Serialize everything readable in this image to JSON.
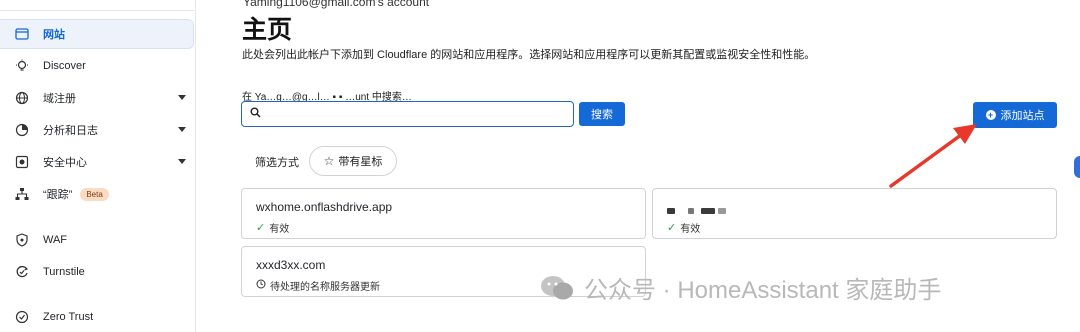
{
  "sidebar": {
    "items": [
      {
        "label": "网站",
        "icon": "browser-window-icon",
        "active": true,
        "caret": false
      },
      {
        "label": "Discover",
        "icon": "lightbulb-icon",
        "active": false,
        "caret": false
      },
      {
        "label": "域注册",
        "icon": "globe-icon",
        "active": false,
        "caret": true
      },
      {
        "label": "分析和日志",
        "icon": "clock-chart-icon",
        "active": false,
        "caret": true
      },
      {
        "label": "安全中心",
        "icon": "shield-gear-icon",
        "active": false,
        "caret": true
      },
      {
        "label": "“跟踪”",
        "icon": "network-tree-icon",
        "active": false,
        "caret": false,
        "badge": "Beta"
      },
      {
        "label": "WAF",
        "icon": "waf-shield-icon",
        "active": false,
        "caret": false
      },
      {
        "label": "Turnstile",
        "icon": "turnstile-icon",
        "active": false,
        "caret": false
      },
      {
        "label": "Zero Trust",
        "icon": "zero-trust-icon",
        "active": false,
        "caret": false
      }
    ]
  },
  "header": {
    "account": "Yaming1106@gmail.com's account",
    "title": "主页",
    "description": "此处会列出此帐户下添加到 Cloudflare 的网站和应用程序。选择网站和应用程序可以更新其配置或监视安全性和性能。"
  },
  "search": {
    "label": "在 Ya…g…@g…l… ▪ ▪ …unt 中搜索…",
    "value": "",
    "button": "搜索"
  },
  "add_site": {
    "label": "添加站点",
    "icon": "plus-circle-icon"
  },
  "filter": {
    "label": "筛选方式",
    "starred": "带有星标",
    "icon": "star-icon"
  },
  "sites": [
    {
      "domain": "wxhome.onflashdrive.app",
      "status": "有效",
      "status_icon": "check-icon"
    },
    {
      "domain": "",
      "status": "有效",
      "status_icon": "check-icon",
      "redacted": true
    },
    {
      "domain": "xxxd3xx.com",
      "status": "待处理的名称服务器更新",
      "status_icon": "clock-icon"
    }
  ],
  "watermark": "公众号 · HomeAssistant 家庭助手",
  "colors": {
    "primary": "#1469d6",
    "arrow": "#e8382c",
    "success": "#2e9b4f",
    "beta_bg": "#fbdcc3"
  }
}
